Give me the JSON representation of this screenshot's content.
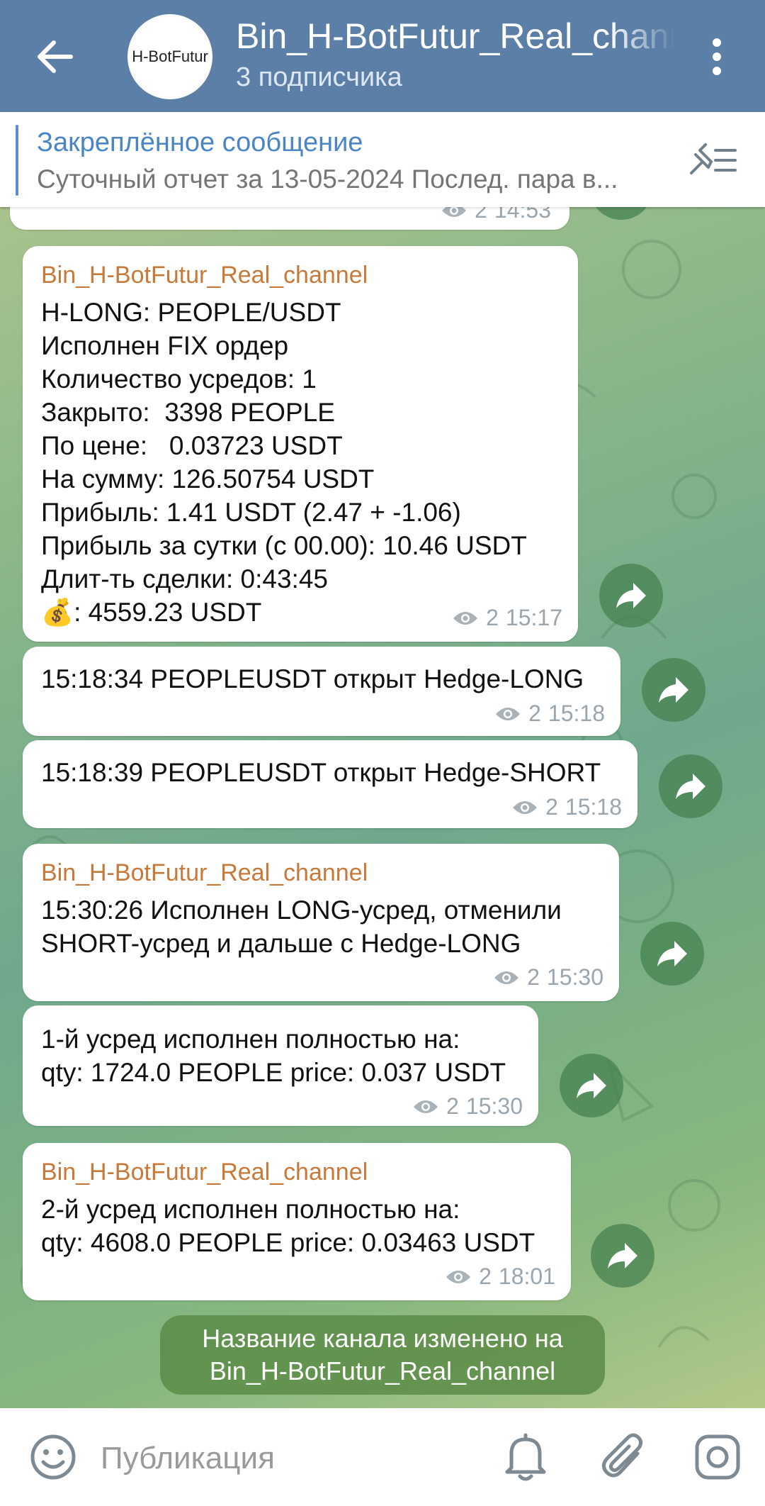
{
  "header": {
    "title": "Bin_H-BotFutur_Real_channel",
    "subtitle": "3 подписчика",
    "avatar_text": "H-BotFutur"
  },
  "pinned": {
    "title": "Закреплённое сообщение",
    "text": "Суточный отчет за 13-05-2024 Послед. пара в..."
  },
  "messages": [
    {
      "author": "",
      "text": "",
      "views": "2",
      "time": "14:53"
    },
    {
      "author": "Bin_H-BotFutur_Real_channel",
      "text": "H-LONG: PEOPLE/USDT\nИсполнен FIX ордер\nКоличество усредов: 1\nЗакрыто:  3398 PEOPLE\nПо цене:   0.03723 USDT\nНа сумму: 126.50754 USDT\nПрибыль: 1.41 USDT (2.47 + -1.06)\nПрибыль за сутки (с 00.00): 10.46 USDT\nДлит-ть сделки: 0:43:45\n💰: 4559.23 USDT",
      "views": "2",
      "time": "15:17"
    },
    {
      "author": "",
      "text": "15:18:34 PEOPLEUSDT открыт Hedge-LONG",
      "views": "2",
      "time": "15:18"
    },
    {
      "author": "",
      "text": "15:18:39 PEOPLEUSDT открыт Hedge-SHORT",
      "views": "2",
      "time": "15:18"
    },
    {
      "author": "Bin_H-BotFutur_Real_channel",
      "text": "15:30:26 Исполнен LONG-усред, отменили\nSHORT-усред и дальше с Hedge-LONG",
      "views": "2",
      "time": "15:30"
    },
    {
      "author": "",
      "text": "1-й усред исполнен полностью на:\nqty: 1724.0 PEOPLE price: 0.037 USDT",
      "views": "2",
      "time": "15:30"
    },
    {
      "author": "Bin_H-BotFutur_Real_channel",
      "text": "2-й усред исполнен полностью на:\nqty: 4608.0 PEOPLE price: 0.03463 USDT",
      "views": "2",
      "time": "18:01"
    }
  ],
  "service_message": {
    "line1": "Название канала изменено на",
    "line2": "Bin_H-BotFutur_Real_channel"
  },
  "composer": {
    "placeholder": "Публикация"
  },
  "icons": [
    "back-arrow-icon",
    "more-vert-icon",
    "pin-list-icon",
    "eye-icon",
    "share-icon",
    "emoji-icon",
    "bell-icon",
    "attach-icon",
    "camera-icon"
  ],
  "colors": {
    "header": "#5b7fa6",
    "author": "#c7793a",
    "pinned_title": "#4a86c5"
  }
}
